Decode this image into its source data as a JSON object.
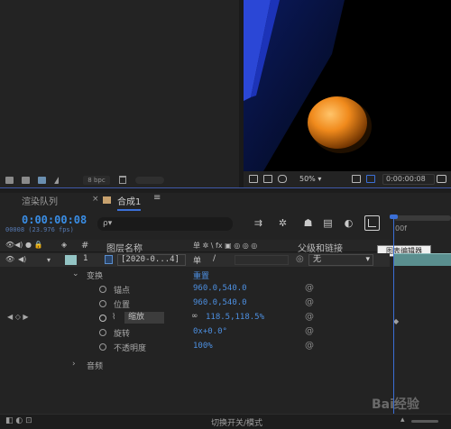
{
  "project": {
    "bpc": "8 bpc"
  },
  "viewer": {
    "zoom": "50%",
    "time": "0:00:00:08"
  },
  "timeline": {
    "tab_render": "渲染队列",
    "tab_close": "×",
    "tab_comp": "合成1",
    "tab_menu": "≡",
    "timecode": "0:00:00:08",
    "frames": "00008 (23.976 fps)",
    "search_icon": "ρ▾",
    "ruler_label": "00f",
    "columns": {
      "hash": "#",
      "layer_name": "图层名称",
      "switches": "单 ✲ \\ fx ▣ ◎ ◎ ◎",
      "parent": "父级和链接"
    },
    "tooltip": "图表编辑器",
    "layer": {
      "index": "1",
      "name": "[2020-0...4]",
      "switch": "单",
      "parent": "无"
    },
    "transform": {
      "label": "变换",
      "reset": "重置"
    },
    "props": [
      {
        "name": "锚点",
        "value": "960.0,540.0"
      },
      {
        "name": "位置",
        "value": "960.0,540.0"
      },
      {
        "name": "缩放",
        "value": "118.5,118.5%"
      },
      {
        "name": "旋转",
        "value": "0x+0.0°"
      },
      {
        "name": "不透明度",
        "value": "100%"
      }
    ],
    "audio": "音频",
    "bottom": "切换开关/模式"
  },
  "watermark": "Bai经验"
}
